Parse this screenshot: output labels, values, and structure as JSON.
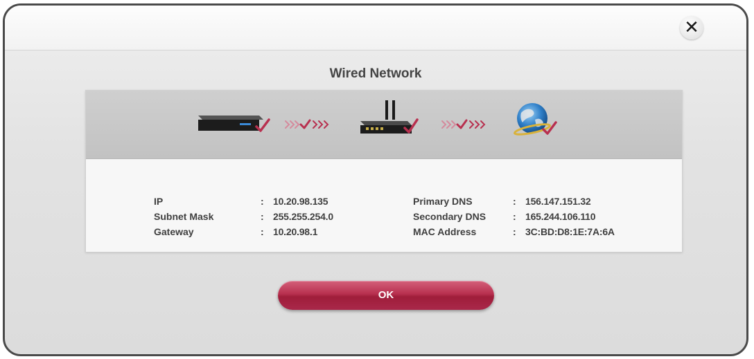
{
  "dialog": {
    "title": "Wired Network",
    "close_icon": "close-icon",
    "ok_label": "OK"
  },
  "diagram": {
    "nodes": [
      "player-device-icon",
      "router-icon",
      "internet-globe-icon"
    ],
    "connector_icon": "connection-arrows-icon",
    "check_color": "#b8304f"
  },
  "network_info": {
    "left": [
      {
        "label": "IP",
        "value": "10.20.98.135"
      },
      {
        "label": "Subnet Mask",
        "value": "255.255.254.0"
      },
      {
        "label": "Gateway",
        "value": "10.20.98.1"
      }
    ],
    "right": [
      {
        "label": "Primary DNS",
        "value": "156.147.151.32"
      },
      {
        "label": "Secondary DNS",
        "value": "165.244.106.110"
      },
      {
        "label": "MAC Address",
        "value": "3C:BD:D8:1E:7A:6A"
      }
    ]
  },
  "colors": {
    "accent": "#b8304f",
    "text": "#3f3f3f"
  }
}
